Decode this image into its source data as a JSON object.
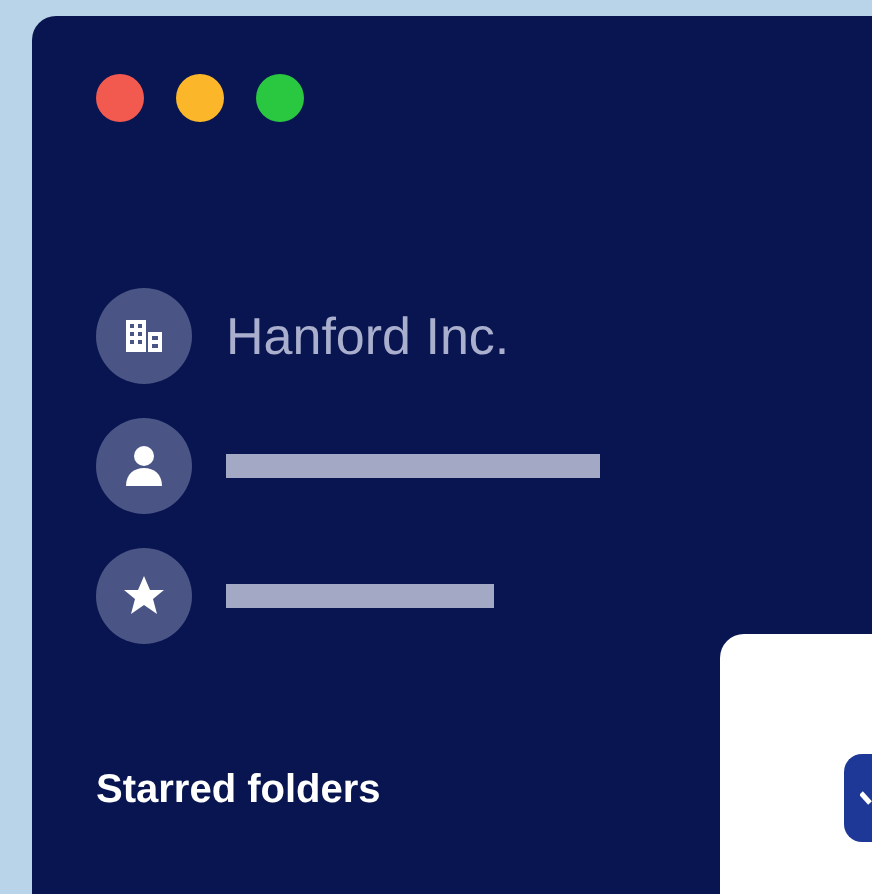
{
  "window": {
    "controls": [
      {
        "color": "#f25a4f"
      },
      {
        "color": "#fbb62a"
      },
      {
        "color": "#2ac740"
      }
    ]
  },
  "sidebar": {
    "items": [
      {
        "kind": "label",
        "text": "Hanford Inc."
      },
      {
        "kind": "skeleton"
      },
      {
        "kind": "skeleton"
      }
    ],
    "section_title": "Starred folders"
  },
  "card": {
    "checkbox": {
      "checked": true
    }
  }
}
